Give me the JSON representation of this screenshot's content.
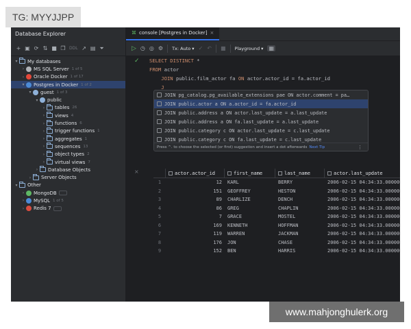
{
  "overlay": {
    "tag": "TG: MYYJJPP",
    "watermark": "www.mahjonghulerk.org"
  },
  "explorer": {
    "title": "Database Explorer",
    "toolbar_text": "DDL",
    "tree": [
      {
        "label": "My databases",
        "badge": "",
        "indent": 0,
        "chev": "▾",
        "icon": "folder"
      },
      {
        "label": "MS SQL Server",
        "badge": "1 of 5",
        "indent": 1,
        "chev": "›",
        "icon": "mssql"
      },
      {
        "label": "Oracle Docker",
        "badge": "1 of 17",
        "indent": 1,
        "chev": "›",
        "icon": "oracle"
      },
      {
        "label": "Postgres in Docker",
        "badge": "1 of 2",
        "indent": 1,
        "chev": "▾",
        "icon": "postgres",
        "selected": true
      },
      {
        "label": "guest",
        "badge": "1 of 3",
        "indent": 2,
        "chev": "▾",
        "icon": "db"
      },
      {
        "label": "public",
        "badge": "",
        "indent": 3,
        "chev": "▾",
        "icon": "schema"
      },
      {
        "label": "tables",
        "badge": "26",
        "indent": 4,
        "chev": "›",
        "icon": "folder"
      },
      {
        "label": "views",
        "badge": "4",
        "indent": 4,
        "chev": "›",
        "icon": "folder"
      },
      {
        "label": "functions",
        "badge": "6",
        "indent": 4,
        "chev": "›",
        "icon": "folder"
      },
      {
        "label": "trigger functions",
        "badge": "1",
        "indent": 4,
        "chev": "›",
        "icon": "folder"
      },
      {
        "label": "aggregates",
        "badge": "1",
        "indent": 4,
        "chev": "›",
        "icon": "folder"
      },
      {
        "label": "sequences",
        "badge": "13",
        "indent": 4,
        "chev": "›",
        "icon": "folder"
      },
      {
        "label": "object types",
        "badge": "2",
        "indent": 4,
        "chev": "›",
        "icon": "folder"
      },
      {
        "label": "virtual views",
        "badge": "7",
        "indent": 4,
        "chev": "›",
        "icon": "folder"
      },
      {
        "label": "Database Objects",
        "badge": "",
        "indent": 3,
        "chev": "›",
        "icon": "folder"
      },
      {
        "label": "Server Objects",
        "badge": "",
        "indent": 2,
        "chev": "›",
        "icon": "folder"
      },
      {
        "label": "Other",
        "badge": "",
        "indent": 0,
        "chev": "▾",
        "icon": "folder"
      },
      {
        "label": "MongoDB",
        "badge": "",
        "indent": 1,
        "chev": "›",
        "icon": "mongo",
        "box": true
      },
      {
        "label": "MySQL",
        "badge": "1 of 5",
        "indent": 1,
        "chev": "›",
        "icon": "mysql"
      },
      {
        "label": "Redis 7",
        "badge": "",
        "indent": 1,
        "chev": "›",
        "icon": "redis",
        "box": true
      }
    ]
  },
  "editor": {
    "tab_label": "console [Postgres in Docker]",
    "tx_mode": "Tx: Auto",
    "schema": "Playground",
    "code": [
      [
        {
          "t": "SELECT DISTINCT ",
          "c": "kw"
        },
        {
          "t": "*",
          "c": ""
        }
      ],
      [
        {
          "t": "FROM ",
          "c": "kw"
        },
        {
          "t": "actor",
          "c": ""
        }
      ],
      [
        {
          "t": "    JOIN ",
          "c": "kw"
        },
        {
          "t": "public.film_actor fa ",
          "c": ""
        },
        {
          "t": "ON ",
          "c": "kw"
        },
        {
          "t": "actor.actor_id = fa.actor_id",
          "c": ""
        }
      ],
      [
        {
          "t": "    J",
          "c": "kw"
        }
      ]
    ],
    "completions": [
      "JOIN pg_catalog.pg_available_extensions pae ON actor.comment = pa…",
      "JOIN public.actor a ON a.actor_id = fa.actor_id",
      "JOIN public.address a ON actor.last_update = a.last_update",
      "JOIN public.address a ON fa.last_update = a.last_update",
      "JOIN public.category c ON actor.last_update = c.last_update",
      "JOIN public.category c ON fa.last_update = c.last_update"
    ],
    "completion_hint": "Press ^. to choose the selected (or first) suggestion and insert a dot afterwards",
    "completion_tip": "Next Tip"
  },
  "results": {
    "columns": [
      "actor.actor_id",
      "first_name",
      "last_name",
      "actor.last_update"
    ],
    "rows": [
      [
        "1",
        "12",
        "KARL",
        "BERRY",
        "2006-02-15 04:34:33.000000"
      ],
      [
        "2",
        "151",
        "GEOFFREY",
        "HESTON",
        "2006-02-15 04:34:33.000000"
      ],
      [
        "3",
        "89",
        "CHARLIZE",
        "DENCH",
        "2006-02-15 04:34:33.000000"
      ],
      [
        "4",
        "86",
        "GREG",
        "CHAPLIN",
        "2006-02-15 04:34:33.000000"
      ],
      [
        "5",
        "7",
        "GRACE",
        "MOSTEL",
        "2006-02-15 04:34:33.000000"
      ],
      [
        "6",
        "169",
        "KENNETH",
        "HOFFMAN",
        "2006-02-15 04:34:33.000000"
      ],
      [
        "7",
        "119",
        "WARREN",
        "JACKMAN",
        "2006-02-15 04:34:33.000000"
      ],
      [
        "8",
        "176",
        "JON",
        "CHASE",
        "2006-02-15 04:34:33.000000"
      ],
      [
        "9",
        "152",
        "BEN",
        "HARRIS",
        "2006-02-15 04:34:33.000000"
      ]
    ]
  }
}
